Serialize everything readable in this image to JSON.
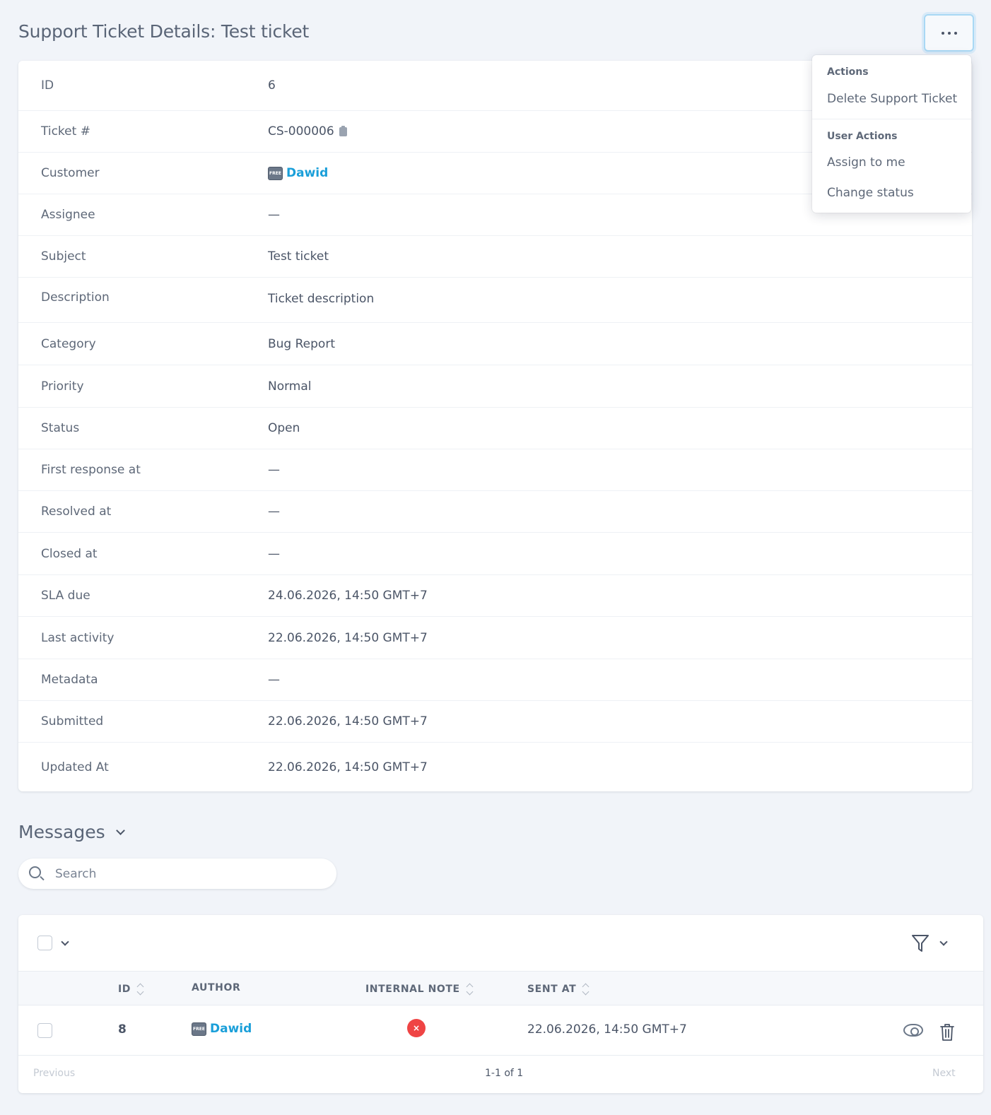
{
  "page": {
    "title": "Support Ticket Details: Test ticket"
  },
  "details": [
    {
      "label": "ID",
      "value": "6"
    },
    {
      "label": "Ticket #",
      "value": "CS-000006"
    },
    {
      "label": "Customer",
      "value": "Dawid"
    },
    {
      "label": "Assignee",
      "value": "—"
    },
    {
      "label": "Subject",
      "value": "Test ticket"
    },
    {
      "label": "Description",
      "value": "Ticket description"
    },
    {
      "label": "Category",
      "value": "Bug Report"
    },
    {
      "label": "Priority",
      "value": "Normal"
    },
    {
      "label": "Status",
      "value": "Open"
    },
    {
      "label": "First response at",
      "value": "—"
    },
    {
      "label": "Resolved at",
      "value": "—"
    },
    {
      "label": "Closed at",
      "value": "—"
    },
    {
      "label": "SLA due",
      "value": "24.06.2026, 14:50 GMT+7"
    },
    {
      "label": "Last activity",
      "value": "22.06.2026, 14:50 GMT+7"
    },
    {
      "label": "Metadata",
      "value": "—"
    },
    {
      "label": "Submitted",
      "value": "22.06.2026, 14:50 GMT+7"
    },
    {
      "label": "Updated At",
      "value": "22.06.2026, 14:50 GMT+7"
    }
  ],
  "badge": {
    "free_label": "FREE"
  },
  "menu": {
    "actions_heading": "Actions",
    "delete_label": "Delete Support Ticket",
    "user_actions_heading": "User Actions",
    "assign_label": "Assign to me",
    "change_status_label": "Change status"
  },
  "messages": {
    "title": "Messages",
    "search_placeholder": "Search",
    "columns": {
      "id": "ID",
      "author": "AUTHOR",
      "internal_note": "INTERNAL NOTE",
      "sent_at": "SENT AT"
    },
    "rows": [
      {
        "id": "8",
        "author": "Dawid",
        "internal_note": "×",
        "sent_at": "22.06.2026, 14:50 GMT+7"
      }
    ],
    "pagination": {
      "previous": "Previous",
      "summary": "1-1 of 1",
      "next": "Next"
    }
  },
  "colors": {
    "link": "#1a9fd9",
    "danger": "#ef4444",
    "background": "#f1f4f9"
  }
}
